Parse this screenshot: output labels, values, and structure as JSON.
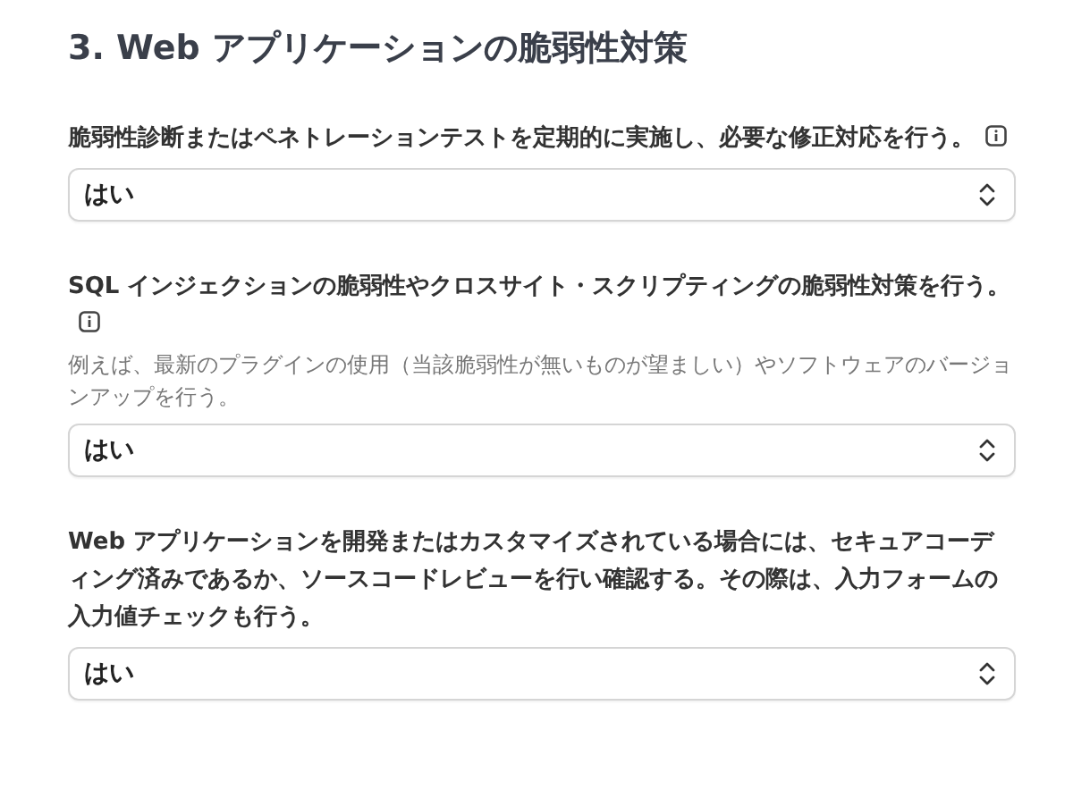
{
  "section_title": "3. Web アプリケーションの脆弱性対策",
  "questions": [
    {
      "label": "脆弱性診断またはペネトレーションテストを定期的に実施し、必要な修正対応を行う。",
      "info": true,
      "value": "はい"
    },
    {
      "label": "SQL インジェクションの脆弱性やクロスサイト・スクリプティングの脆弱性対策を行う。",
      "info": true,
      "hint": "例えば、最新のプラグインの使用（当該脆弱性が無いものが望ましい）やソフトウェアのバージョンアップを行う。",
      "value": "はい"
    },
    {
      "label": "Web アプリケーションを開発またはカスタマイズされている場合には、セキュアコーディング済みであるか、ソースコードレビューを行い確認する。その際は、入力フォームの入力値チェックも行う。",
      "info": false,
      "value": "はい"
    }
  ]
}
